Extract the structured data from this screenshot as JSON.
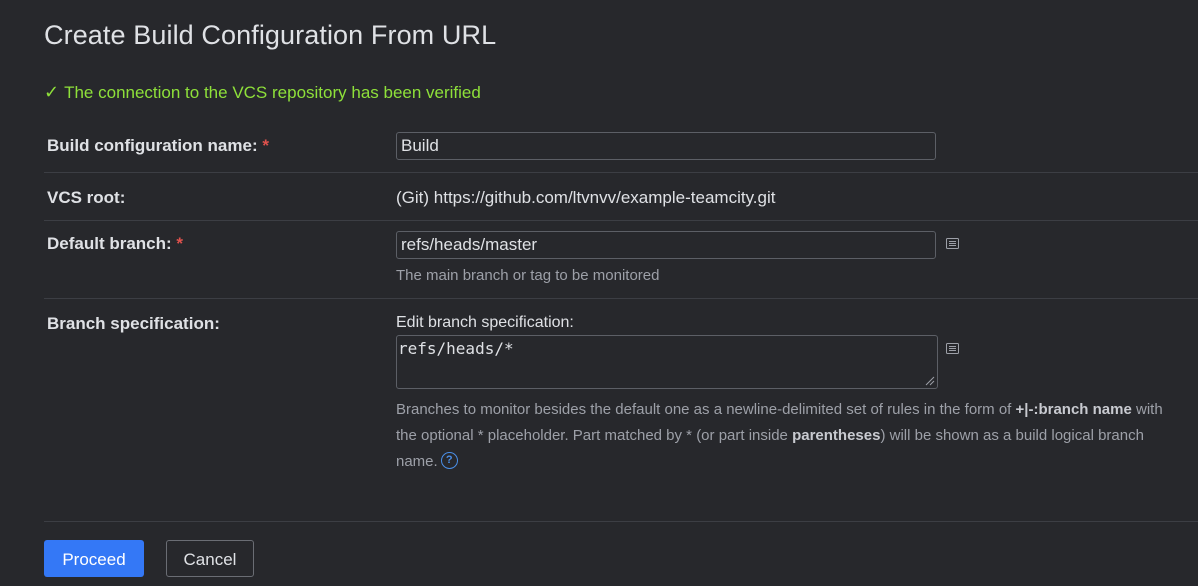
{
  "page": {
    "title": "Create Build Configuration From URL",
    "verified_message": "The connection to the VCS repository has been verified"
  },
  "form": {
    "build_name": {
      "label": "Build configuration name:",
      "required_mark": "*",
      "value": "Build"
    },
    "vcs_root": {
      "label": "VCS root:",
      "value": "(Git) https://github.com/ltvnvv/example-teamcity.git"
    },
    "default_branch": {
      "label": "Default branch:",
      "required_mark": "*",
      "value": "refs/heads/master",
      "hint": "The main branch or tag to be monitored"
    },
    "branch_spec": {
      "label": "Branch specification:",
      "edit_label": "Edit branch specification:",
      "value": "refs/heads/*",
      "desc_part1": "Branches to monitor besides the default one as a newline-delimited set of rules in the form of ",
      "desc_bold1": "+|-:branch name",
      "desc_part2": " with the optional * placeholder. Part matched by * (or part inside ",
      "desc_bold2": "parentheses",
      "desc_part3": ") will be shown as a build logical branch name.",
      "help_glyph": "?"
    }
  },
  "buttons": {
    "proceed": "Proceed",
    "cancel": "Cancel"
  },
  "colors": {
    "background": "#27282c",
    "success": "#8ee03a",
    "primary": "#3478f6",
    "required": "#e0524d"
  },
  "icons": {
    "verified": "check-icon",
    "edit": "text-editor-icon",
    "help": "help-icon"
  }
}
